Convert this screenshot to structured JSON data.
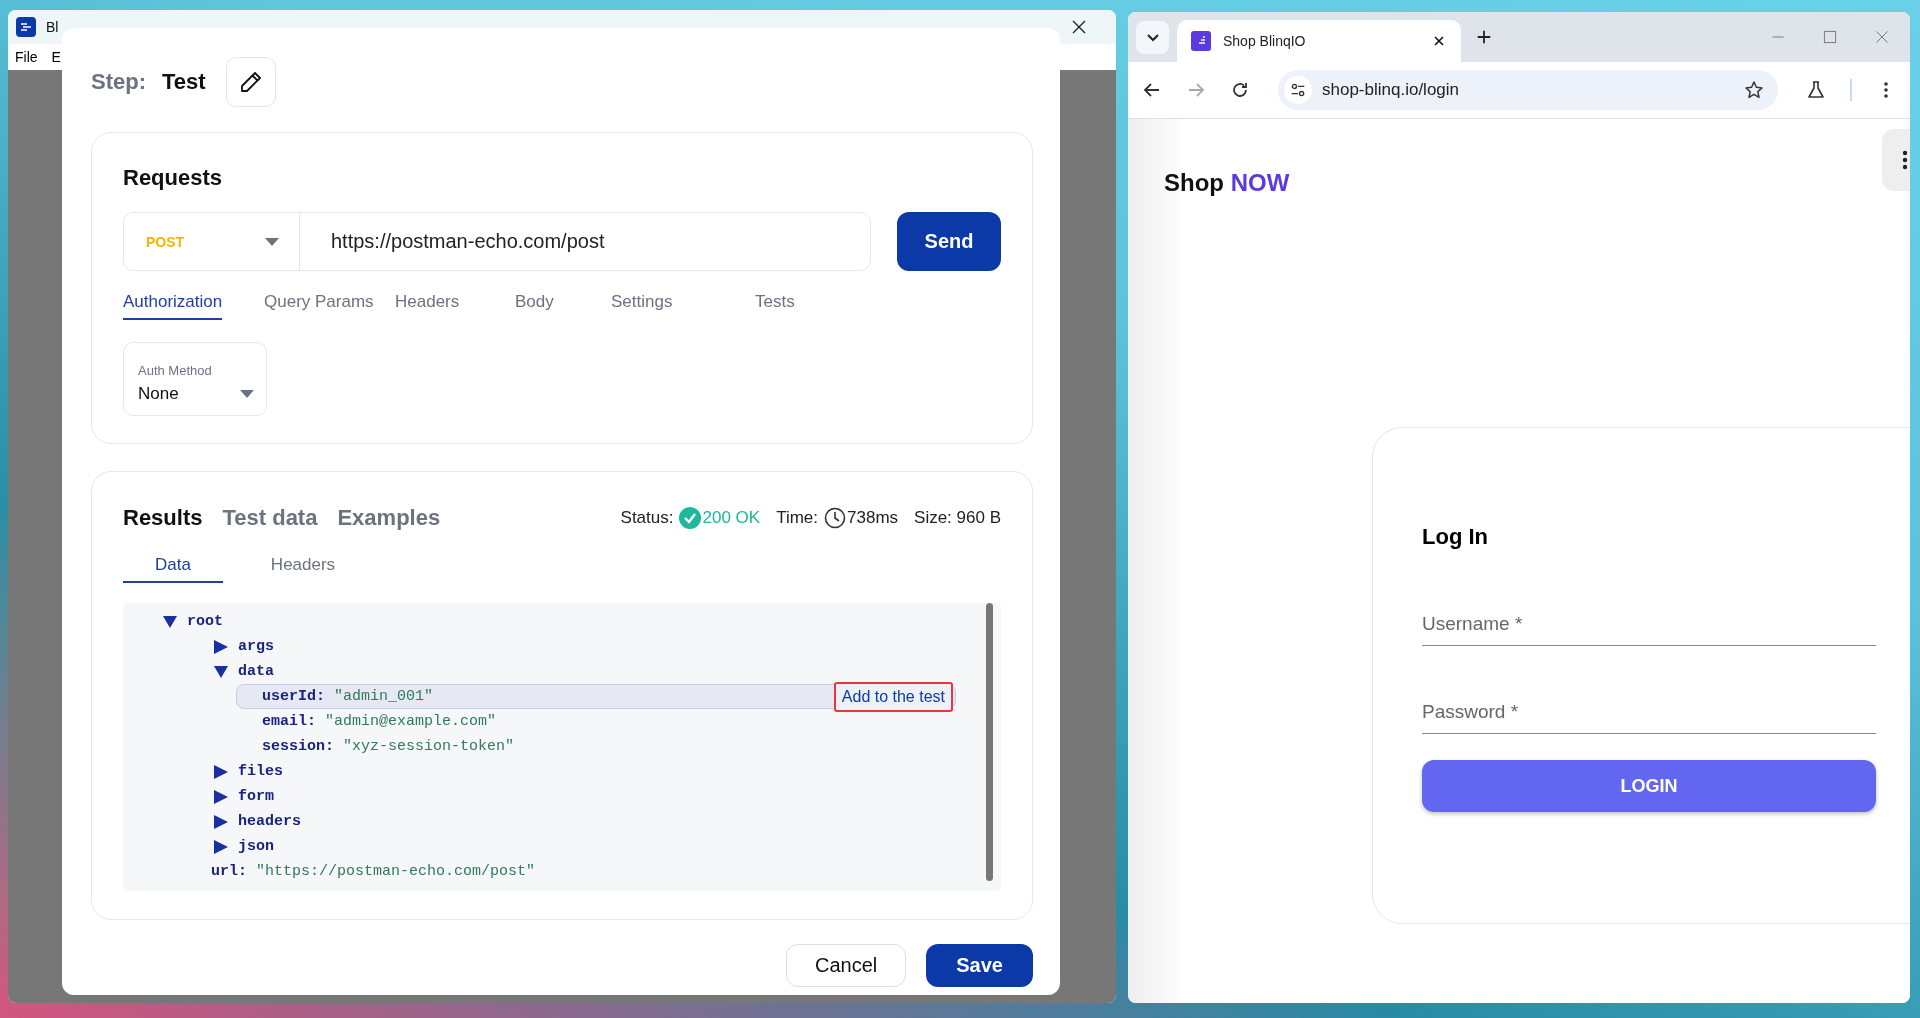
{
  "recorder": {
    "title": "Bl",
    "menu": [
      "File",
      "E"
    ],
    "modal": {
      "step_label": "Step:",
      "step_name": "Test",
      "requests": {
        "title": "Requests",
        "method": "POST",
        "url": "https://postman-echo.com/post",
        "send": "Send",
        "tabs": [
          {
            "label": "Authorization",
            "selected": true
          },
          {
            "label": "Query Params",
            "selected": false
          },
          {
            "label": "Headers",
            "selected": false
          },
          {
            "label": "Body",
            "selected": false
          },
          {
            "label": "Settings",
            "selected": false
          },
          {
            "label": "Tests",
            "selected": false
          }
        ],
        "auth": {
          "label": "Auth Method",
          "value": "None"
        }
      },
      "results": {
        "tabs": [
          {
            "label": "Results",
            "selected": true
          },
          {
            "label": "Test data",
            "selected": false
          },
          {
            "label": "Examples",
            "selected": false
          }
        ],
        "status_label": "Status:",
        "status": "200 OK",
        "time_label": "Time:",
        "time": "738ms",
        "size": "Size: 960 B",
        "subtabs": [
          {
            "label": "Data",
            "selected": true
          },
          {
            "label": "Headers",
            "selected": false
          }
        ],
        "tree": [
          {
            "key": "root",
            "expanded": true,
            "children": [
              {
                "key": "args",
                "expanded": false
              },
              {
                "key": "data",
                "expanded": true,
                "children": [
                  {
                    "key": "userId:",
                    "value": "\"admin_001\"",
                    "selected": true,
                    "action": "Add to the test"
                  },
                  {
                    "key": "email:",
                    "value": "\"admin@example.com\"",
                    "selected": false
                  },
                  {
                    "key": "session:",
                    "value": "\"xyz-session-token\"",
                    "selected": false
                  }
                ]
              },
              {
                "key": "files",
                "expanded": false
              },
              {
                "key": "form",
                "expanded": false
              },
              {
                "key": "headers",
                "expanded": false
              },
              {
                "key": "json",
                "expanded": false
              },
              {
                "key": "url:",
                "value": "\"https://postman-echo.com/post\"",
                "selected": false
              }
            ]
          }
        ]
      },
      "buttons": [
        {
          "label": "Cancel",
          "kind": "secondary"
        },
        {
          "label": "Save",
          "kind": "primary"
        }
      ]
    }
  },
  "browser": {
    "tab_title": "Shop BlinqIO",
    "address": "shop-blinq.io/login",
    "brand": {
      "first": "Shop",
      "second": "NOW"
    },
    "login": {
      "title": "Log In",
      "fields": [
        {
          "placeholder": "Username *"
        },
        {
          "placeholder": "Password *"
        }
      ],
      "button": "LOGIN"
    }
  }
}
